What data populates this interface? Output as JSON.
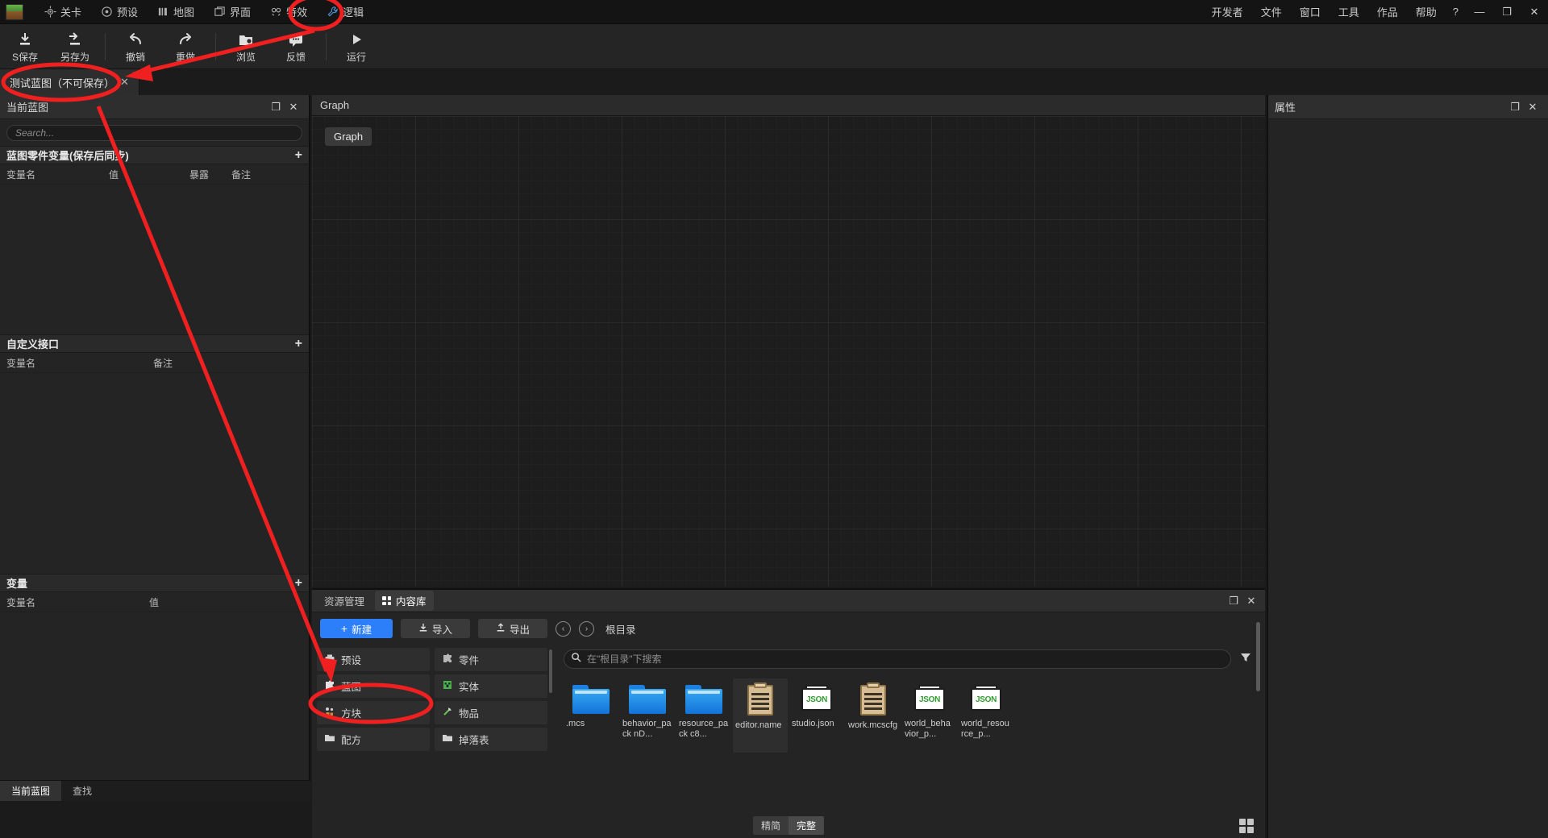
{
  "menubar": {
    "left_items": [
      {
        "label": "关卡",
        "icon": "target-icon"
      },
      {
        "label": "预设",
        "icon": "circle-dot-icon"
      },
      {
        "label": "地图",
        "icon": "map-bars-icon"
      },
      {
        "label": "界面",
        "icon": "window-icon"
      },
      {
        "label": "特效",
        "icon": "sparkle-icon"
      },
      {
        "label": "逻辑",
        "icon": "wrench-icon"
      }
    ],
    "right_items": [
      "开发者",
      "文件",
      "窗口",
      "工具",
      "作品",
      "帮助"
    ],
    "help_glyph": "?",
    "window_controls": {
      "minimize": "—",
      "maximize": "❐",
      "close": "✕"
    }
  },
  "toolbar": {
    "buttons": [
      {
        "label": "S保存",
        "icon": "save-download-icon"
      },
      {
        "label": "另存为",
        "icon": "save-as-icon"
      },
      {
        "label": "撤销",
        "icon": "undo-arrow-icon"
      },
      {
        "label": "重做",
        "icon": "redo-arrow-icon"
      },
      {
        "label": "浏览",
        "icon": "folder-search-icon"
      },
      {
        "label": "反馈",
        "icon": "chat-bubble-icon"
      },
      {
        "label": "运行",
        "icon": "play-triangle-icon"
      }
    ]
  },
  "document_tab": {
    "label": "测试蓝图（不可保存）",
    "close": "✕"
  },
  "left_panel": {
    "title": "当前蓝图",
    "maximize": "❐",
    "close": "✕",
    "search_placeholder": "Search...",
    "sections": [
      {
        "title": "蓝图零件变量(保存后同步)",
        "add": "+",
        "columns": [
          "变量名",
          "值",
          "暴露",
          "备注"
        ],
        "rows": []
      },
      {
        "title": "自定义接口",
        "add": "+",
        "columns": [
          "变量名",
          "备注"
        ],
        "rows": []
      },
      {
        "title": "变量",
        "add": "+",
        "columns": [
          "变量名",
          "值"
        ],
        "rows": []
      }
    ],
    "bottom_tabs": [
      {
        "label": "当前蓝图",
        "active": true
      },
      {
        "label": "查找",
        "active": false
      }
    ]
  },
  "graph_panel": {
    "title": "Graph",
    "chip_label": "Graph"
  },
  "right_panel": {
    "title": "属性",
    "maximize": "❐",
    "close": "✕"
  },
  "library": {
    "tabs": [
      {
        "label": "资源管理",
        "active": false,
        "icon": "none"
      },
      {
        "label": "内容库",
        "active": true,
        "icon": "grid-icon"
      }
    ],
    "maximize": "❐",
    "close": "✕",
    "buttons": {
      "new": "新建",
      "new_icon": "plus-icon",
      "import": "导入",
      "import_icon": "import-arrow-icon",
      "export": "导出",
      "export_icon": "export-arrow-icon"
    },
    "nav": {
      "back": "‹",
      "forward": "›",
      "breadcrumb": "根目录"
    },
    "categories": [
      {
        "label": "预设",
        "icon": "preset-icon"
      },
      {
        "label": "零件",
        "icon": "part-puzzle-icon"
      },
      {
        "label": "蓝图",
        "icon": "blueprint-puzzle-icon"
      },
      {
        "label": "实体",
        "icon": "entity-creeper-icon"
      },
      {
        "label": "方块",
        "icon": "block-icon"
      },
      {
        "label": "物品",
        "icon": "item-pickaxe-icon"
      },
      {
        "label": "配方",
        "icon": "recipe-folder-icon"
      },
      {
        "label": "掉落表",
        "icon": "droptable-folder-icon"
      }
    ],
    "search_placeholder": "在\"根目录\"下搜索",
    "filter_icon": "filter-funnel-icon",
    "files": [
      {
        "name": ".mcs",
        "type": "folder",
        "selected": false
      },
      {
        "name": "behavior_pack nD...",
        "type": "folder",
        "selected": false
      },
      {
        "name": "resource_pack c8...",
        "type": "folder",
        "selected": false
      },
      {
        "name": "editor.name",
        "type": "document",
        "selected": true
      },
      {
        "name": "studio.json",
        "type": "json",
        "selected": false
      },
      {
        "name": "work.mcscfg",
        "type": "document",
        "selected": false
      },
      {
        "name": "world_behavior_p...",
        "type": "json",
        "selected": false
      },
      {
        "name": "world_resource_p...",
        "type": "json",
        "selected": false
      }
    ],
    "view_modes": [
      {
        "label": "精简",
        "active": false
      },
      {
        "label": "完整",
        "active": true
      }
    ],
    "grid_view_icon": "grid-view-icon"
  },
  "annotations": {
    "color": "#f02020",
    "ellipses": [
      {
        "name": "logic-menu-highlight"
      },
      {
        "name": "document-tab-highlight"
      },
      {
        "name": "blueprint-category-highlight"
      }
    ],
    "arrows": [
      {
        "name": "arrow-to-document-tab"
      },
      {
        "name": "arrow-to-blueprint-category"
      }
    ]
  }
}
